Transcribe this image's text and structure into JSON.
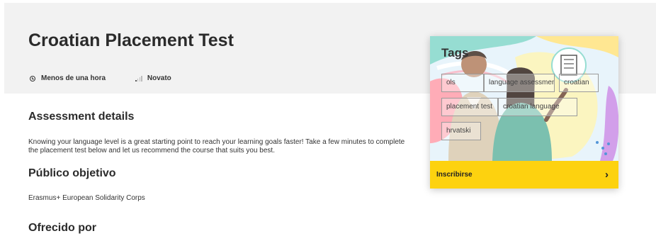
{
  "course": {
    "title": "Croatian Placement Test",
    "duration": "Menos de una hora",
    "level": "Novato"
  },
  "sections": {
    "details_heading": "Assessment details",
    "details_text": "Knowing your language level is a great starting point to reach your learning goals faster! Take a few minutes to complete the placement test below and let us recommend the course that suits you best.",
    "audience_heading": "Público objetivo",
    "audience_text": "Erasmus+ European Solidarity Corps",
    "offered_heading": "Ofrecido por"
  },
  "card": {
    "tags_title": "Tags",
    "tags": [
      "ols",
      "language assessment",
      "croatian",
      "placement test",
      "croatian language",
      "hrvatski"
    ],
    "enroll_label": "Inscribirse"
  },
  "colors": {
    "accent": "#fdd20f",
    "hero_background": "#f2f2f2",
    "text": "#2b2b2b"
  },
  "icons": {
    "duration": "clock-icon",
    "level": "signal-bars-icon",
    "enroll": "chevron-right-icon"
  }
}
